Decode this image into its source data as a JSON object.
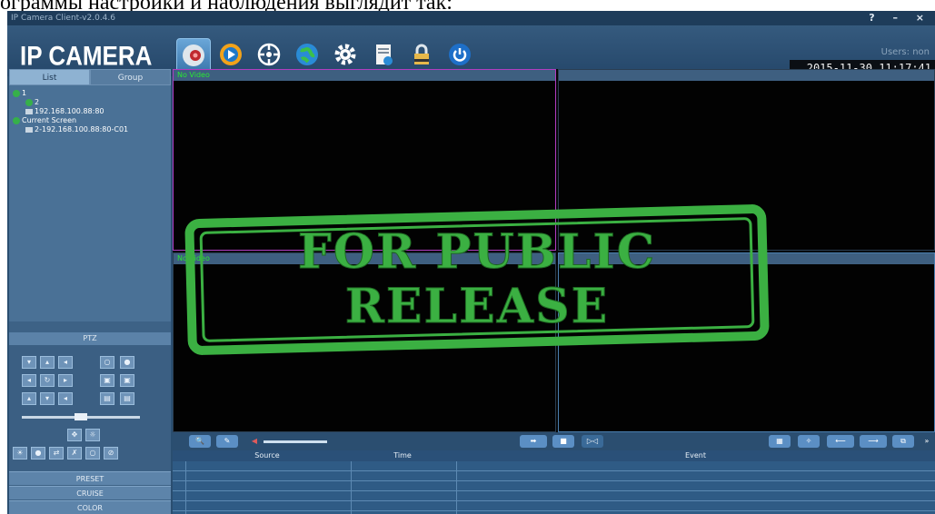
{
  "caption": "ограммы настройки и наблюдения выглядит так:",
  "window": {
    "title": "IP Camera Client-v2.0.4.6",
    "controls": "? – ×",
    "logo": "IP CAMERA",
    "users": "Users: non",
    "datetime": "2015-11-30  11:17:41"
  },
  "toolbar": [
    "live-view-icon",
    "playback-icon",
    "ptz-icon",
    "network-icon",
    "settings-icon",
    "log-icon",
    "lock-icon",
    "power-icon"
  ],
  "left": {
    "tabs": [
      "List",
      "Group"
    ],
    "tree": [
      {
        "label": "1",
        "indent": 0
      },
      {
        "label": "2",
        "indent": 1
      },
      {
        "label": "192.168.100.88:80",
        "indent": 1
      },
      {
        "label": "Current Screen",
        "indent": 0
      },
      {
        "label": "2-192.168.100.88:80-C01",
        "indent": 1
      }
    ],
    "ptz_label": "PTZ",
    "menus": [
      "PRESET",
      "CRUISE",
      "COLOR"
    ]
  },
  "video": {
    "pane_label": "No Video",
    "pane_label_2": "No Video"
  },
  "events": {
    "headers": [
      "Source",
      "Time",
      "Event"
    ]
  },
  "stamp": {
    "line1": "FOR PUBLIC",
    "line2": "RELEASE"
  },
  "colors": {
    "stamp": "#3bb042",
    "no_video": "#2ae832"
  }
}
